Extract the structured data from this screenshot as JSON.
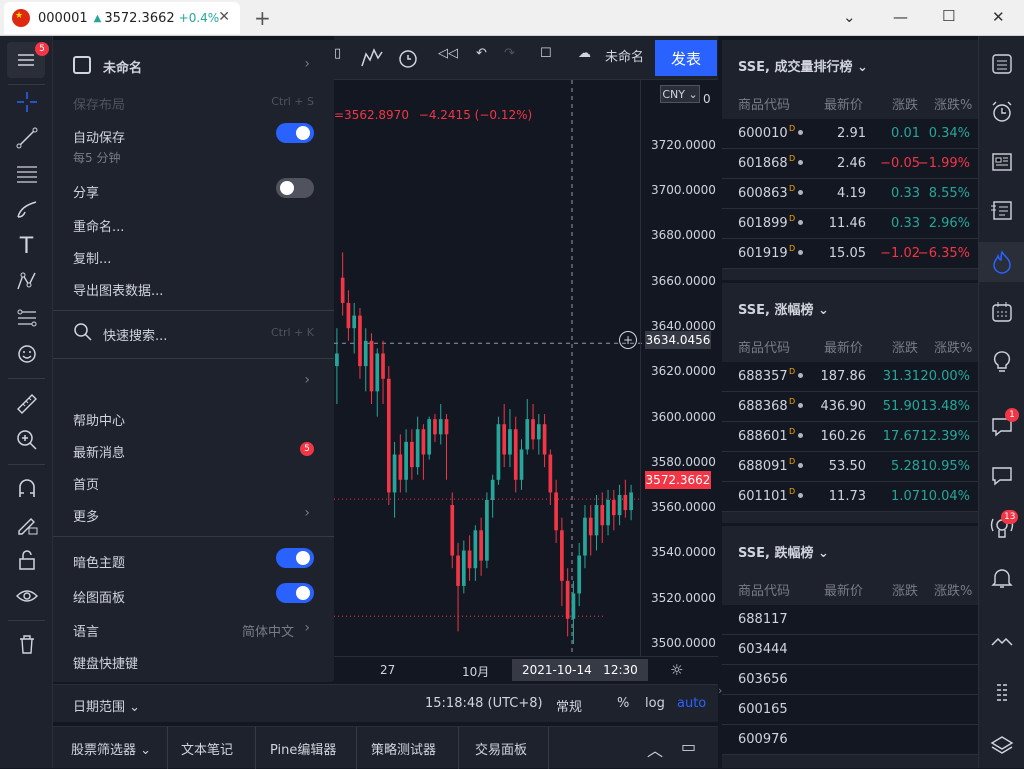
{
  "window": {
    "tab_code": "000001",
    "tab_price": "3572.3662",
    "tab_change": "+0.4%",
    "tab_close": "✕",
    "new_tab": "+"
  },
  "left_toolbar": {
    "menu_badge": "5",
    "icons": [
      "crosshair-icon",
      "trend-line-icon",
      "fib-icon",
      "brush-icon",
      "text-icon",
      "pattern-icon",
      "prediction-icon",
      "emoji-icon",
      "ruler-icon",
      "zoom-icon",
      "magnet-icon",
      "lock-drawing-icon",
      "lock-icon",
      "eye-icon",
      "trash-icon"
    ]
  },
  "top_toolbar": {
    "layout_name": "未命名",
    "publish": "发表"
  },
  "legend": {
    "ohlc": "=3562.8970",
    "change": "−4.2415 (−0.12%)"
  },
  "price_axis": {
    "currency": "CNY",
    "partial_top": "0",
    "ticks": [
      "3720.0000",
      "3700.0000",
      "3680.0000",
      "3660.0000",
      "3640.0000",
      "3620.0000",
      "3600.0000",
      "3580.0000",
      "3560.0000",
      "3540.0000",
      "3520.0000",
      "3500.0000"
    ],
    "crosshair_price": "3634.0456",
    "last_price": "3572.3662"
  },
  "time_axis": {
    "labels": [
      "27",
      "10月"
    ],
    "crosshair_time": "2021-10-14   12:30"
  },
  "bottom_bar": {
    "date_range": "日期范围",
    "clock": "15:18:48 (UTC+8)",
    "session": "常规",
    "percent": "%",
    "log": "log",
    "auto": "auto"
  },
  "panel_tabs": [
    "股票筛选器",
    "文本笔记",
    "Pine编辑器",
    "策略测试器",
    "交易面板"
  ],
  "menu": {
    "title": "未命名",
    "save_layout": "保存布局",
    "save_shortcut": "Ctrl + S",
    "autosave": "自动保存",
    "autosave_sub": "每5 分钟",
    "share": "分享",
    "rename": "重命名...",
    "copy": "复制...",
    "export": "导出图表数据...",
    "quick_search": "快速搜索...",
    "quick_search_shortcut": "Ctrl + K",
    "help": "帮助中心",
    "news": "最新消息",
    "news_badge": "5",
    "home": "首页",
    "more": "更多",
    "dark_theme": "暗色主题",
    "drawing_panel": "绘图面板",
    "language": "语言",
    "language_value": "简体中文",
    "hotkeys": "键盘快捷键"
  },
  "watchlists": [
    {
      "title": "SSE, 成交量排行榜",
      "columns": [
        "商品代码",
        "最新价",
        "涨跌",
        "涨跌%"
      ],
      "rows": [
        {
          "code": "600010",
          "price": "2.91",
          "chg": "0.01",
          "pct": "0.34%",
          "dir": "pos"
        },
        {
          "code": "601868",
          "price": "2.46",
          "chg": "−0.05",
          "pct": "−1.99%",
          "dir": "neg"
        },
        {
          "code": "600863",
          "price": "4.19",
          "chg": "0.33",
          "pct": "8.55%",
          "dir": "pos"
        },
        {
          "code": "601899",
          "price": "11.46",
          "chg": "0.33",
          "pct": "2.96%",
          "dir": "pos"
        },
        {
          "code": "601919",
          "price": "15.05",
          "chg": "−1.02",
          "pct": "−6.35%",
          "dir": "neg"
        }
      ]
    },
    {
      "title": "SSE, 涨幅榜",
      "columns": [
        "商品代码",
        "最新价",
        "涨跌",
        "涨跌%"
      ],
      "rows": [
        {
          "code": "688357",
          "price": "187.86",
          "chg": "31.31",
          "pct": "20.00%",
          "dir": "pos"
        },
        {
          "code": "688368",
          "price": "436.90",
          "chg": "51.90",
          "pct": "13.48%",
          "dir": "pos"
        },
        {
          "code": "688601",
          "price": "160.26",
          "chg": "17.67",
          "pct": "12.39%",
          "dir": "pos"
        },
        {
          "code": "688091",
          "price": "53.50",
          "chg": "5.28",
          "pct": "10.95%",
          "dir": "pos"
        },
        {
          "code": "601101",
          "price": "11.73",
          "chg": "1.07",
          "pct": "10.04%",
          "dir": "pos"
        }
      ]
    },
    {
      "title": "SSE, 跌幅榜",
      "columns": [
        "商品代码",
        "最新价",
        "涨跌",
        "涨跌%"
      ],
      "rows": [
        {
          "code": "688117"
        },
        {
          "code": "603444"
        },
        {
          "code": "603656"
        },
        {
          "code": "600165"
        },
        {
          "code": "600976"
        }
      ]
    }
  ],
  "right_toolbar": {
    "chat_badge": "1",
    "stream_badge": "13"
  },
  "colors": {
    "up": "#26a69a",
    "down": "#f23645",
    "accent": "#2962ff",
    "background": "#131722",
    "panel": "#1e222d"
  }
}
